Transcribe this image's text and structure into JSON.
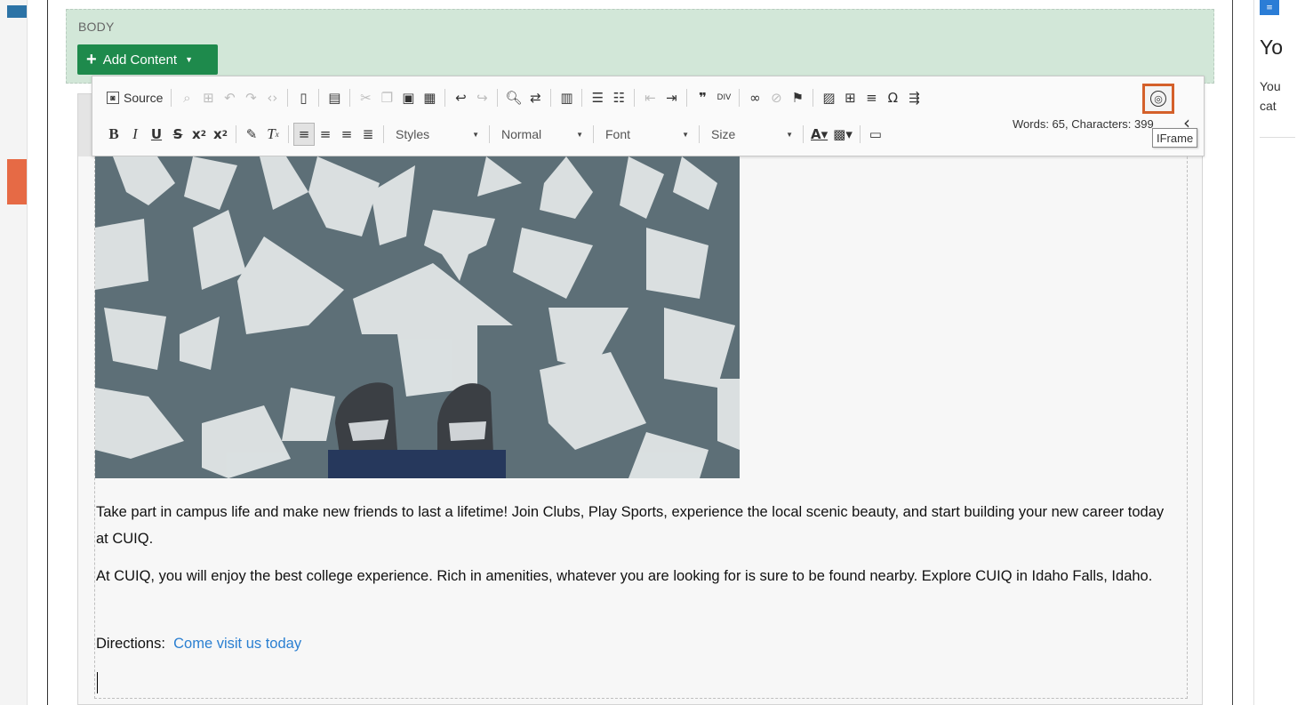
{
  "body_section": {
    "label": "BODY",
    "add_content_label": "Add Content"
  },
  "toolbar": {
    "row1": {
      "source_label": "Source"
    },
    "row2": {
      "styles_label": "Styles",
      "format_label": "Normal",
      "font_label": "Font",
      "size_label": "Size"
    },
    "word_count": "Words: 65, Characters: 399",
    "iframe_tooltip": "IFrame",
    "icons": [
      "source-icon",
      "preview-icon",
      "select-all-icon",
      "undo-icon",
      "redo-icon",
      "show-blocks-icon",
      "new-page-icon",
      "templates-icon",
      "cut-icon",
      "copy-icon",
      "paste-icon",
      "paste-text-icon",
      "undo-arrow-icon",
      "redo-arrow-icon",
      "find-icon",
      "replace-icon",
      "spellcheck-icon",
      "numbered-list-icon",
      "bulleted-list-icon",
      "outdent-icon",
      "indent-icon",
      "blockquote-icon",
      "div-icon",
      "link-icon",
      "unlink-icon",
      "anchor-icon",
      "image-icon",
      "table-icon",
      "horizontal-line-icon",
      "special-char-icon",
      "page-break-icon",
      "iframe-icon"
    ]
  },
  "content": {
    "image_alt": "",
    "paragraph1": "Take part in campus life and make new friends to last a lifetime!  Join Clubs, Play Sports, experience the local scenic beauty, and start building your new career today at CUIQ.",
    "paragraph2": "At CUIQ, you will enjoy the best college experience. Rich in amenities, whatever you are looking for is sure to be found nearby.  Explore CUIQ in Idaho Falls, Idaho.",
    "directions_label": "Directions:  ",
    "directions_link": "Come visit us today"
  },
  "right_panel": {
    "title": "Yo",
    "text_line1": "You",
    "text_line2": "cat"
  },
  "colors": {
    "add_content_green": "#1e8a4c",
    "body_band": "#d2e7d8",
    "highlight_orange": "#d4602a",
    "link_blue": "#2a7fd1"
  }
}
